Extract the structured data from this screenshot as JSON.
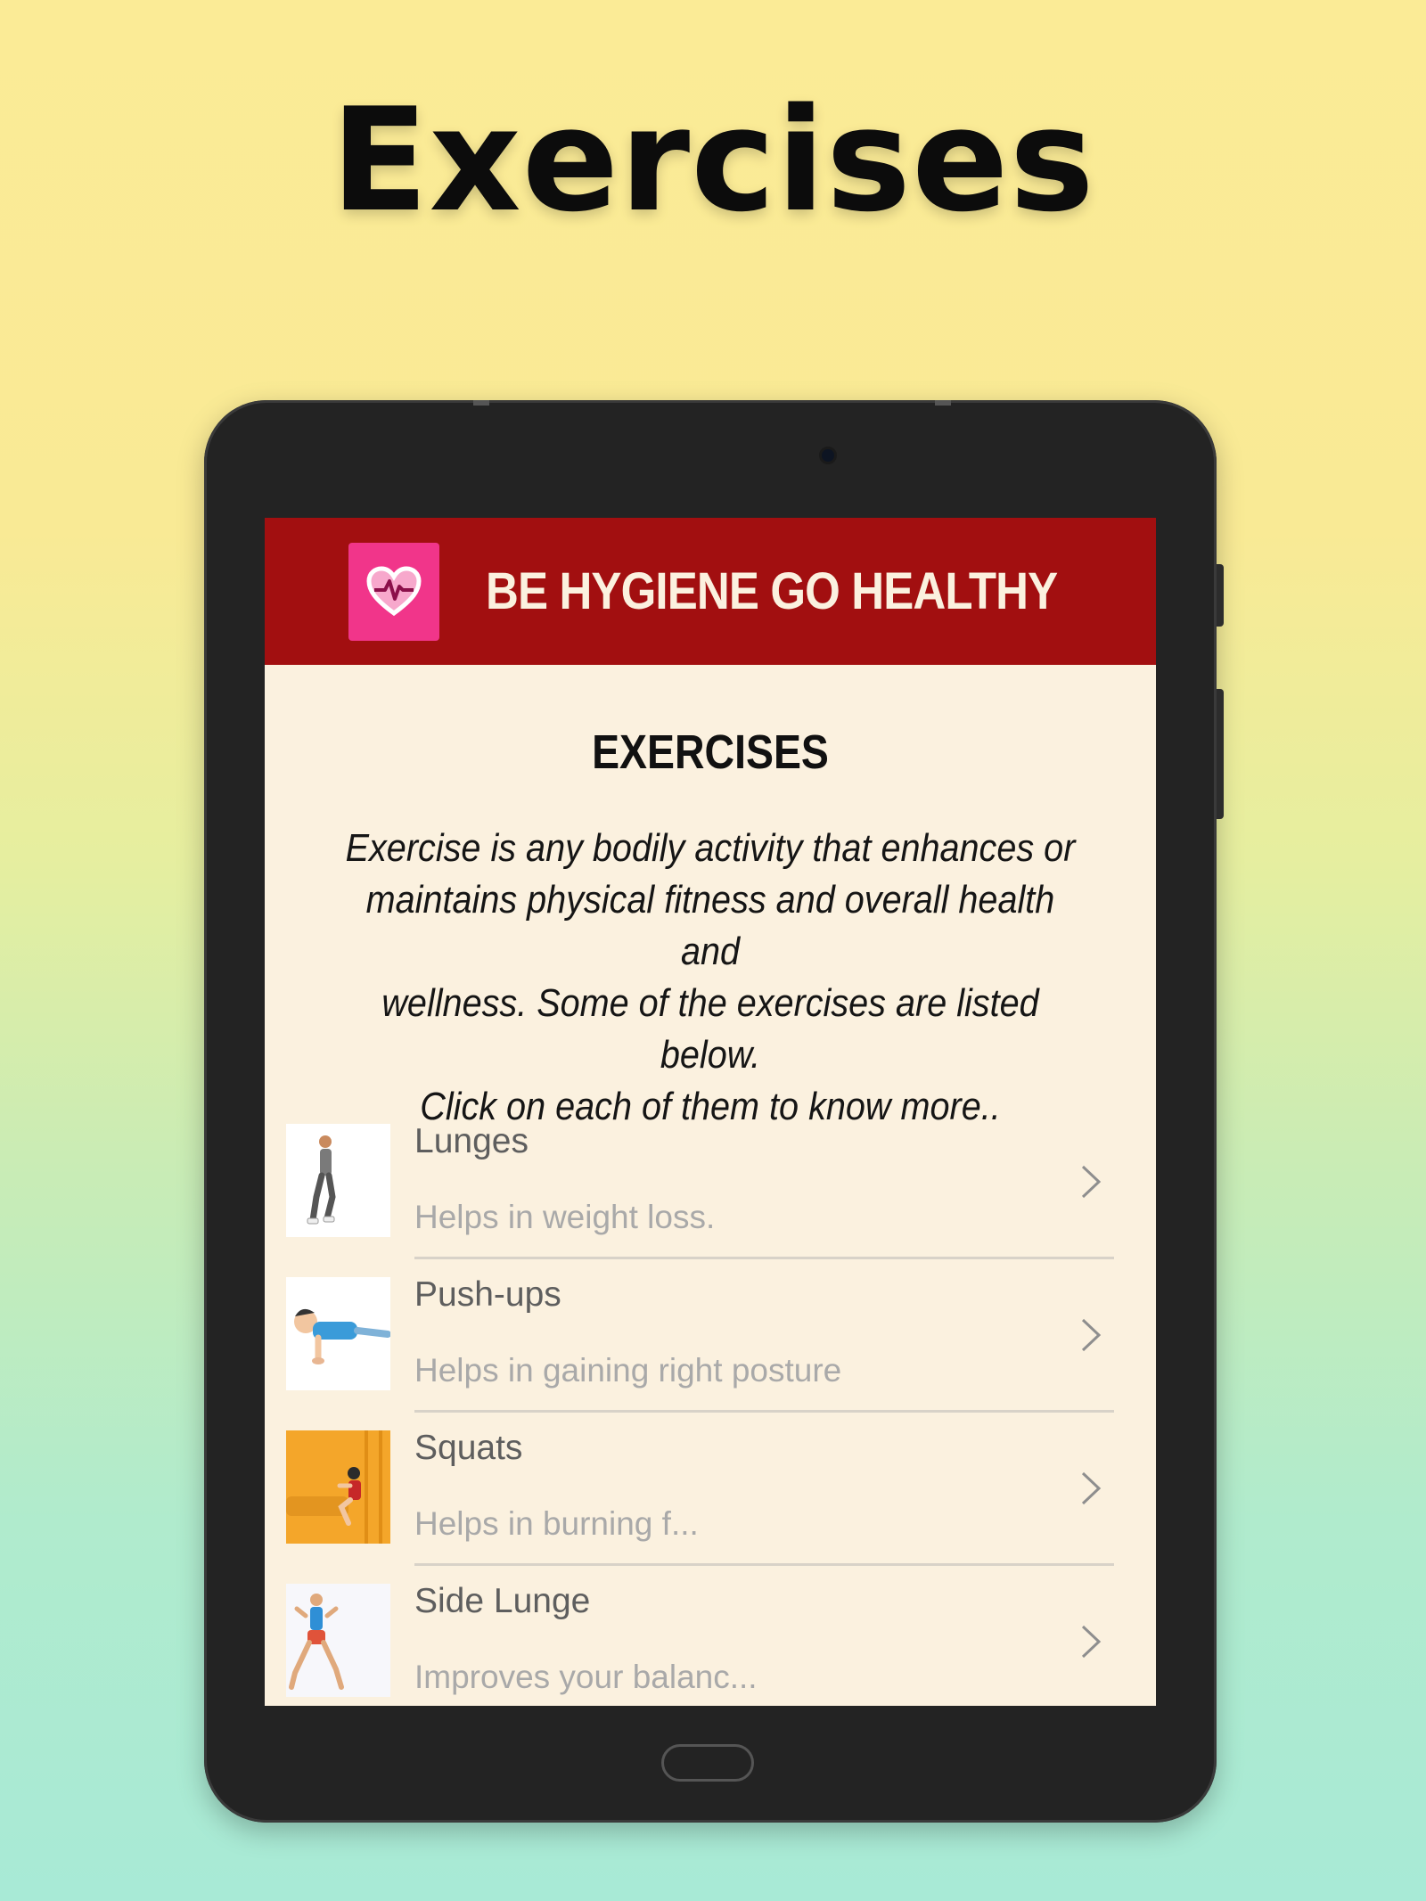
{
  "promo": {
    "title": "Exercises"
  },
  "app": {
    "logo_icon": "heart-pulse-icon",
    "header_title": "BE HYGIENE GO HEALTHY",
    "colors": {
      "header": "#a20f10",
      "logo_bg": "#f1358a",
      "screen_bg": "#fbf1df"
    }
  },
  "content": {
    "section_title": "EXERCISES",
    "intro": "Exercise is any bodily activity that enhances or\nmaintains physical fitness and overall health and\nwellness.  Some of the exercises are listed below.\nClick on each of them to know more.."
  },
  "exercises": [
    {
      "title": "Lunges",
      "subtitle": "Helps in weight loss.",
      "thumbnail": "lunges-illustration"
    },
    {
      "title": "Push-ups",
      "subtitle": "Helps in gaining right posture",
      "thumbnail": "push-ups-illustration"
    },
    {
      "title": "Squats",
      "subtitle": "Helps in burning f...",
      "thumbnail": "squats-illustration"
    },
    {
      "title": "Side Lunge",
      "subtitle": "Improves your balanc...",
      "thumbnail": "side-lunge-illustration"
    }
  ]
}
